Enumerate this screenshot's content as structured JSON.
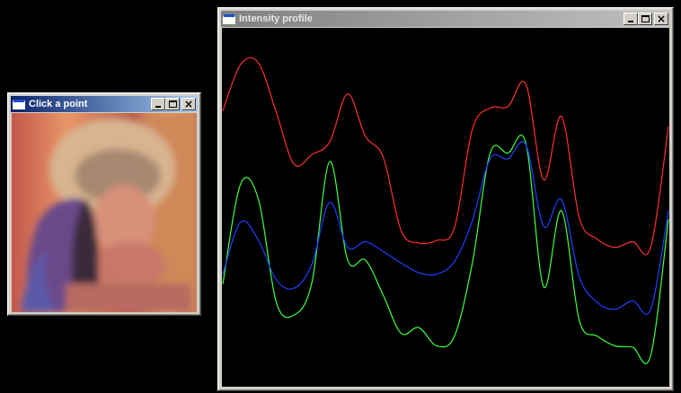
{
  "windows": {
    "click": {
      "title": "Click a point"
    },
    "profile": {
      "title": "Intensity profile"
    }
  },
  "icons": {
    "app": "window-icon",
    "minimize": "minimize-icon",
    "maximize": "maximize-icon",
    "close": "close-icon"
  },
  "colors": {
    "desktop": "#000000",
    "title_active": "#0a246a",
    "title_inactive": "#808080",
    "red_channel": "#ff3030",
    "green_channel": "#40ff40",
    "blue_channel": "#2040ff"
  },
  "chart_data": {
    "type": "line",
    "title": "",
    "xlabel": "",
    "ylabel": "",
    "grid": false,
    "legend": "none",
    "ylim": [
      0,
      255
    ],
    "x": [
      0,
      4,
      8,
      12,
      16,
      20,
      24,
      28,
      32,
      36,
      40,
      44,
      48,
      52,
      56,
      60,
      64,
      68,
      72,
      76,
      80,
      84,
      88,
      92,
      96,
      100
    ],
    "series": [
      {
        "values": [
          196,
          229,
          230,
          195,
          158,
          165,
          174,
          208,
          178,
          163,
          111,
          102,
          104,
          113,
          183,
          198,
          199,
          215,
          147,
          192,
          120,
          105,
          99,
          103,
          99,
          185
        ]
      },
      {
        "values": [
          73,
          144,
          133,
          60,
          51,
          74,
          160,
          90,
          90,
          65,
          38,
          42,
          29,
          36,
          88,
          166,
          166,
          173,
          71,
          125,
          47,
          36,
          29,
          28,
          22,
          119
        ]
      },
      {
        "values": [
          80,
          117,
          104,
          76,
          70,
          87,
          131,
          99,
          103,
          96,
          88,
          81,
          80,
          89,
          118,
          162,
          162,
          172,
          114,
          133,
          78,
          60,
          55,
          61,
          55,
          125
        ]
      }
    ]
  }
}
